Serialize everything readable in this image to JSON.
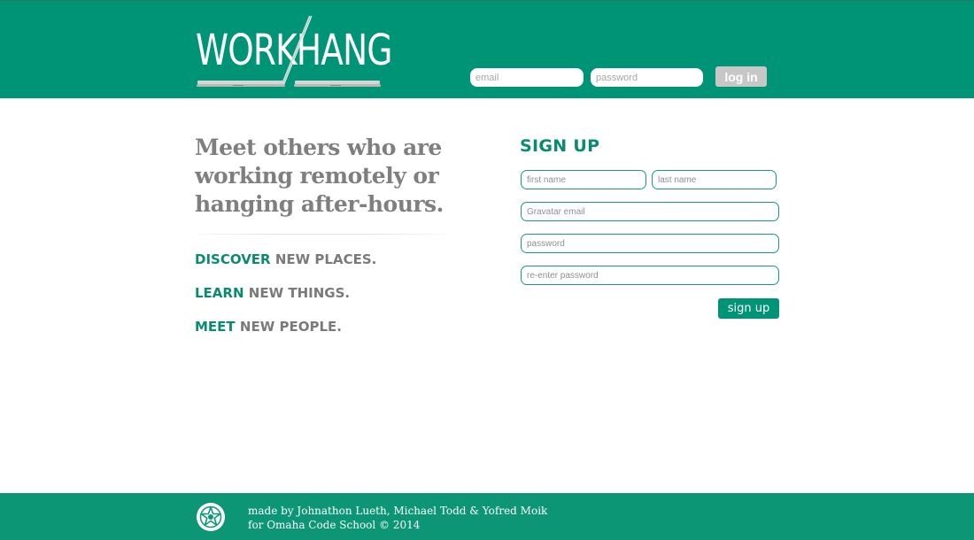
{
  "brand": {
    "logo_text": "WORKHANG"
  },
  "login": {
    "email_placeholder": "email",
    "password_placeholder": "password",
    "button_label": "log in"
  },
  "hero": {
    "headline": "Meet others who are working remotely or hanging after-hours.",
    "taglines": [
      {
        "accent": "DISCOVER",
        "rest": "NEW PLACES."
      },
      {
        "accent": "LEARN",
        "rest": "NEW THINGS."
      },
      {
        "accent": "MEET",
        "rest": "NEW PEOPLE."
      }
    ]
  },
  "signup": {
    "title": "SIGN UP",
    "first_name_placeholder": "first name",
    "last_name_placeholder": "last name",
    "gravatar_placeholder": "Gravatar email",
    "password_placeholder": "password",
    "reenter_placeholder": "re-enter password",
    "button_label": "sign up"
  },
  "footer": {
    "credits_line1": "made by Johnathon Lueth, Michael Todd & Yofred Moik",
    "credits_line2": "for Omaha Code School © 2014",
    "badge_icon": "star-badge-icon"
  },
  "colors": {
    "brand_green": "#009477",
    "accent_text": "#0a8a6e",
    "muted_text": "#7f7f7f",
    "login_button": "#c7c7c7"
  }
}
